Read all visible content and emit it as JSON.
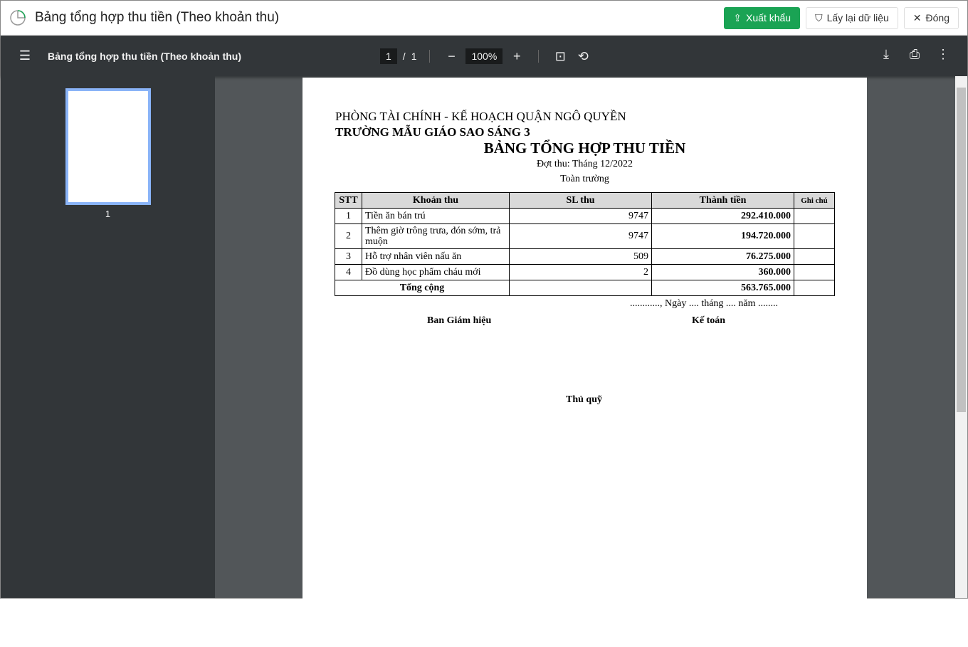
{
  "app": {
    "title": "Bảng tổng hợp thu tiền (Theo khoản thu)",
    "export": "Xuất khẩu",
    "reload": "Lấy lại dữ liệu",
    "close": "Đóng"
  },
  "viewer": {
    "doc_title": "Bảng tổng hợp thu tiền (Theo khoản thu)",
    "page": "1",
    "pages": "1",
    "zoom": "100%",
    "thumb_label": "1"
  },
  "doc": {
    "dept": "PHÒNG TÀI CHÍNH - KẾ HOẠCH QUẬN NGÔ QUYỀN",
    "school": "TRƯỜNG MẪU GIÁO SAO SÁNG 3",
    "title": "BẢNG TỔNG HỢP THU TIỀN",
    "period": "Đợt thu: Tháng 12/2022",
    "scope": "Toàn trường",
    "headers": [
      "STT",
      "Khoản thu",
      "SL thu",
      "Thành tiền",
      "Ghi chú"
    ],
    "rows": [
      [
        "1",
        "Tiền ăn bán trú",
        "9747",
        "292.410.000",
        ""
      ],
      [
        "2",
        "Thêm giờ trông trưa, đón sớm, trả muộn",
        "9747",
        "194.720.000",
        ""
      ],
      [
        "3",
        "Hỗ trợ nhân viên nấu ăn",
        "509",
        "76.275.000",
        ""
      ],
      [
        "4",
        "Đồ dùng học phẩm cháu mới",
        "2",
        "360.000",
        ""
      ]
    ],
    "total_label": "Tổng cộng",
    "total": "563.765.000",
    "date_line": "............, Ngày .... tháng .... năm ........",
    "sig1": "Ban Giám hiệu",
    "sig2": "Kế toán",
    "sig3": "Thủ quỹ"
  }
}
